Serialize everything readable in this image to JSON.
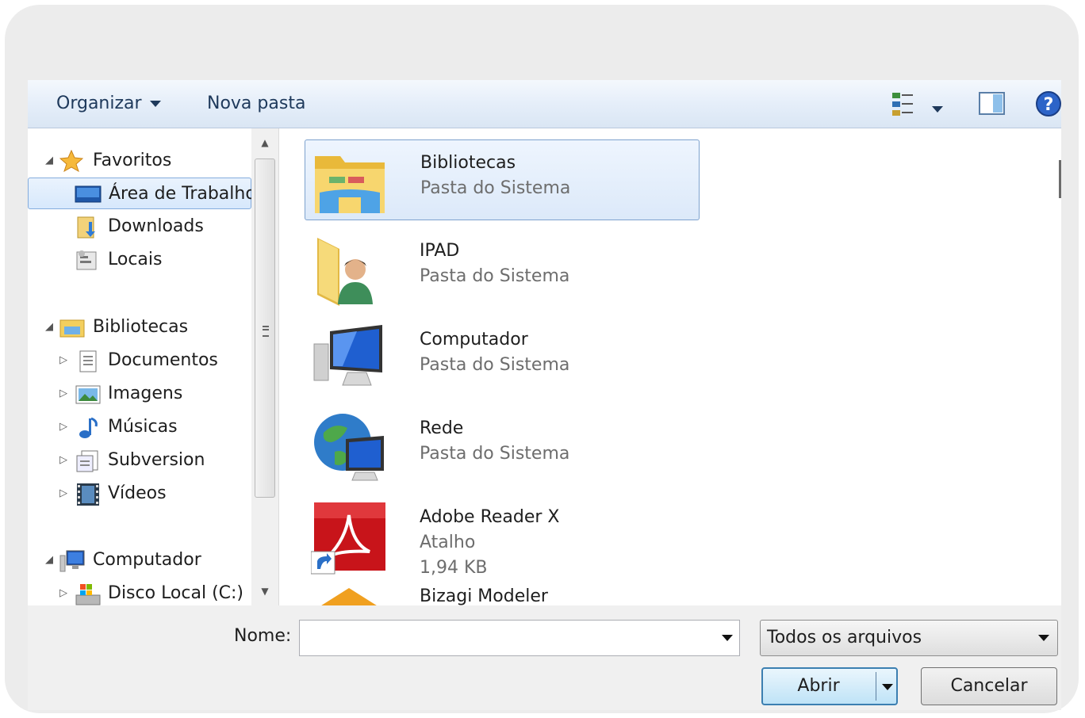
{
  "toolbar": {
    "organize_label": "Organizar",
    "new_folder_label": "Nova pasta",
    "view_icon": "views-icon",
    "preview_icon": "preview-pane-icon",
    "help_icon": "help-icon"
  },
  "nav": {
    "favorites": {
      "label": "Favoritos",
      "items": [
        {
          "label": "Área de Trabalho",
          "icon": "desktop-icon",
          "selected": true
        },
        {
          "label": "Downloads",
          "icon": "downloads-icon"
        },
        {
          "label": "Locais",
          "icon": "recent-places-icon"
        }
      ]
    },
    "libraries": {
      "label": "Bibliotecas",
      "items": [
        {
          "label": "Documentos",
          "icon": "documents-icon"
        },
        {
          "label": "Imagens",
          "icon": "pictures-icon"
        },
        {
          "label": "Músicas",
          "icon": "music-icon"
        },
        {
          "label": "Subversion",
          "icon": "subversion-icon"
        },
        {
          "label": "Vídeos",
          "icon": "videos-icon"
        }
      ]
    },
    "computer": {
      "label": "Computador",
      "items": [
        {
          "label": "Disco Local (C:)",
          "icon": "local-disk-icon"
        }
      ]
    }
  },
  "content": {
    "items": [
      {
        "name": "Bibliotecas",
        "sub": "Pasta do Sistema",
        "icon": "libraries-folder-icon",
        "selected": true
      },
      {
        "name": "IPAD",
        "sub": "Pasta do Sistema",
        "icon": "user-folder-icon"
      },
      {
        "name": "Computador",
        "sub": "Pasta do Sistema",
        "icon": "computer-icon"
      },
      {
        "name": "Rede",
        "sub": "Pasta do Sistema",
        "icon": "network-icon"
      },
      {
        "name": "Adobe Reader X",
        "sub": "Atalho",
        "sub2": "1,94 KB",
        "icon": "adobe-reader-icon"
      },
      {
        "name": "Bizagi Modeler",
        "icon": "bizagi-icon"
      }
    ]
  },
  "footer": {
    "name_label": "Nome:",
    "name_value": "",
    "file_type": "Todos os arquivos",
    "open_label": "Abrir",
    "cancel_label": "Cancelar"
  }
}
